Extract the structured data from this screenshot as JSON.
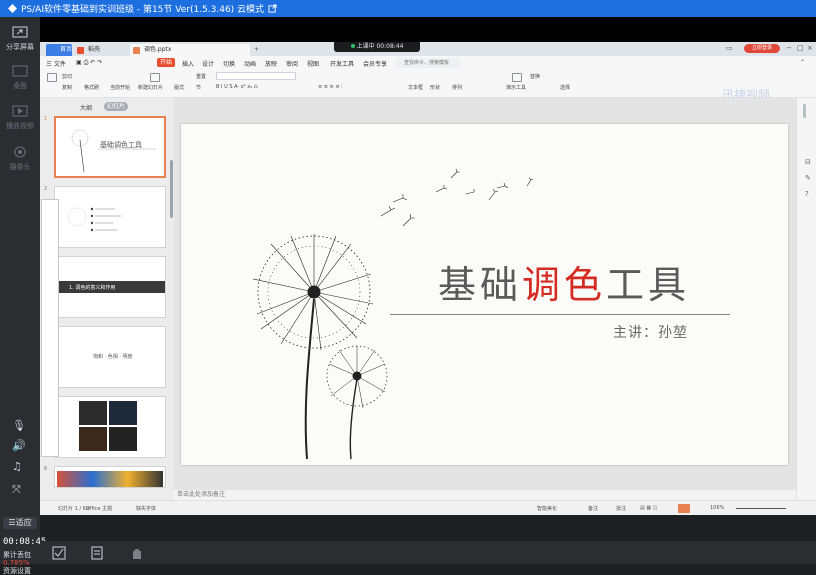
{
  "window_title": "PS/AI软件零基础到实训班级 - 第15节 Ver(1.5.3.46) 云模式",
  "left_rail": {
    "share_screen": "分享屏幕",
    "btn2": "桌面",
    "btn3": "播放视频",
    "btn4": "摄像头",
    "adapt": "适应",
    "timecode": "00:08:45",
    "loss_label": "累计丢包",
    "loss_value": "0.785%",
    "resource": "资源设置"
  },
  "wps": {
    "tabs": [
      "首页",
      "稻壳",
      "调色.pptx"
    ],
    "recording": "上课中 00:08:44",
    "login": "立即登录",
    "menus": [
      "三 文件",
      "开始",
      "插入",
      "设计",
      "切换",
      "动画",
      "放映",
      "审阅",
      "视图",
      "开发工具",
      "会员专享"
    ],
    "search_placeholder": "查找命令、搜索模板",
    "ribbon_labels": [
      "剪切",
      "复制",
      "格式刷",
      "当前开始",
      "新建幻灯片",
      "版式",
      "节",
      "重置",
      "文本框",
      "形状",
      "排列",
      "演示工具",
      "替换",
      "选择"
    ],
    "watermark": "迅捷视频",
    "panel_tabs": [
      "大纲",
      "幻灯片"
    ],
    "slide_numbers": [
      "1",
      "2",
      "3",
      "4",
      "5",
      "6"
    ],
    "thumb_texts": [
      "基础调色工具",
      "1. 调色的意义和作用",
      "饱和 · 色相 · 明度"
    ],
    "add_slide": "+",
    "slide_title_pre": "基础",
    "slide_title_red": "调色",
    "slide_title_post": "工具",
    "speaker": "主讲：孙堃",
    "notes_placeholder": "单击此处添加备注",
    "status": {
      "slide_count": "幻灯片 1 / 69",
      "theme": "Office 主题",
      "font_missing": "缺失字体",
      "smart_beautify": "智能美化",
      "notes": "备注",
      "comments": "批注",
      "zoom": "106%"
    }
  },
  "colors": {
    "title_bar": "#1d6fe0",
    "accent": "#e74c2e",
    "title_red": "#d42b22"
  },
  "icons": [
    "share-screen-icon",
    "microphone-icon",
    "speaker-icon",
    "music-icon",
    "fullscreen-icon",
    "checkbox-icon",
    "document-icon",
    "hand-raise-icon"
  ]
}
